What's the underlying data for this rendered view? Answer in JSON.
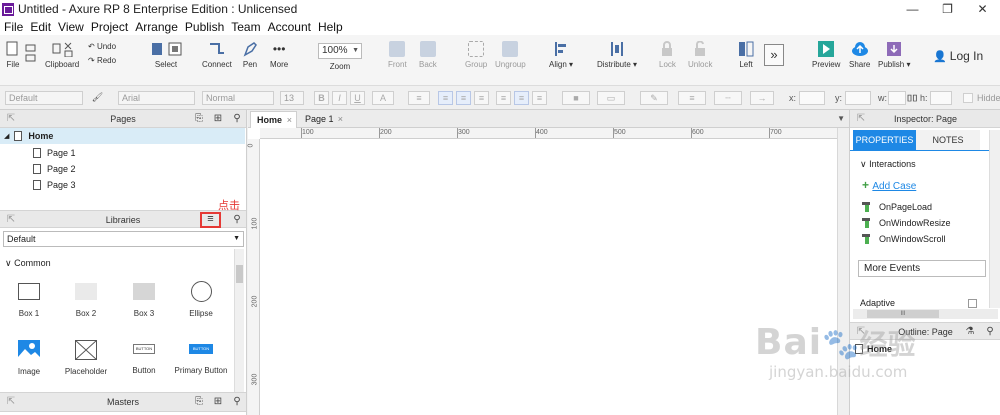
{
  "window": {
    "title": "Untitled - Axure RP 8 Enterprise Edition : Unlicensed",
    "controls": [
      "—",
      "❐",
      "✕"
    ]
  },
  "menu": [
    "File",
    "Edit",
    "View",
    "Project",
    "Arrange",
    "Publish",
    "Team",
    "Account",
    "Help"
  ],
  "toolbar": {
    "file": "File",
    "clipboard": "Clipboard",
    "undo": "Undo",
    "redo": "Redo",
    "select": "Select",
    "connect": "Connect",
    "pen": "Pen",
    "more": "More",
    "zoom_value": "100%",
    "zoom": "Zoom",
    "front": "Front",
    "back": "Back",
    "group": "Group",
    "ungroup": "Ungroup",
    "align": "Align",
    "distribute": "Distribute",
    "lock": "Lock",
    "unlock": "Unlock",
    "left": "Left",
    "preview": "Preview",
    "share": "Share",
    "publish": "Publish",
    "login": "Log In"
  },
  "formatbar": {
    "style": "Default",
    "font": "Arial",
    "weight": "Normal",
    "size": "13",
    "x_label": "x:",
    "y_label": "y:",
    "w_label": "w:",
    "h_label": "h:",
    "hidden_label": "Hidden"
  },
  "pages_panel": {
    "title": "Pages",
    "items": [
      "Home",
      "Page 1",
      "Page 2",
      "Page 3"
    ]
  },
  "libraries_panel": {
    "title": "Libraries",
    "annotation": "点击",
    "selected_library": "Default",
    "section": "Common",
    "widgets": [
      "Box 1",
      "Box 2",
      "Box 3",
      "Ellipse",
      "Image",
      "Placeholder",
      "Button",
      "Primary Button"
    ],
    "button_text": "BUTTON"
  },
  "masters_panel": {
    "title": "Masters"
  },
  "canvas": {
    "tabs": [
      "Home",
      "Page 1"
    ],
    "hruler": [
      "100",
      "200",
      "300",
      "400",
      "500",
      "600",
      "700"
    ],
    "vruler": [
      "0",
      "100",
      "200",
      "300"
    ]
  },
  "inspector": {
    "title": "Inspector: Page",
    "tabs": [
      "PROPERTIES",
      "NOTES"
    ],
    "section": "Interactions",
    "add_case": "Add Case",
    "events": [
      "OnPageLoad",
      "OnWindowResize",
      "OnWindowScroll"
    ],
    "more_events": "More Events",
    "adaptive": "Adaptive",
    "scroll_glyph": "III"
  },
  "outline": {
    "title": "Outline: Page",
    "root": "Home"
  },
  "watermark": {
    "brand": "Bai",
    "brand_tail": "经验",
    "url": "jingyan.baidu.com"
  },
  "colors": {
    "accent_blue": "#1e88e5",
    "selection_bg": "#d9ecf7",
    "annotation_red": "#e53935",
    "preview_green": "#26a69a"
  }
}
